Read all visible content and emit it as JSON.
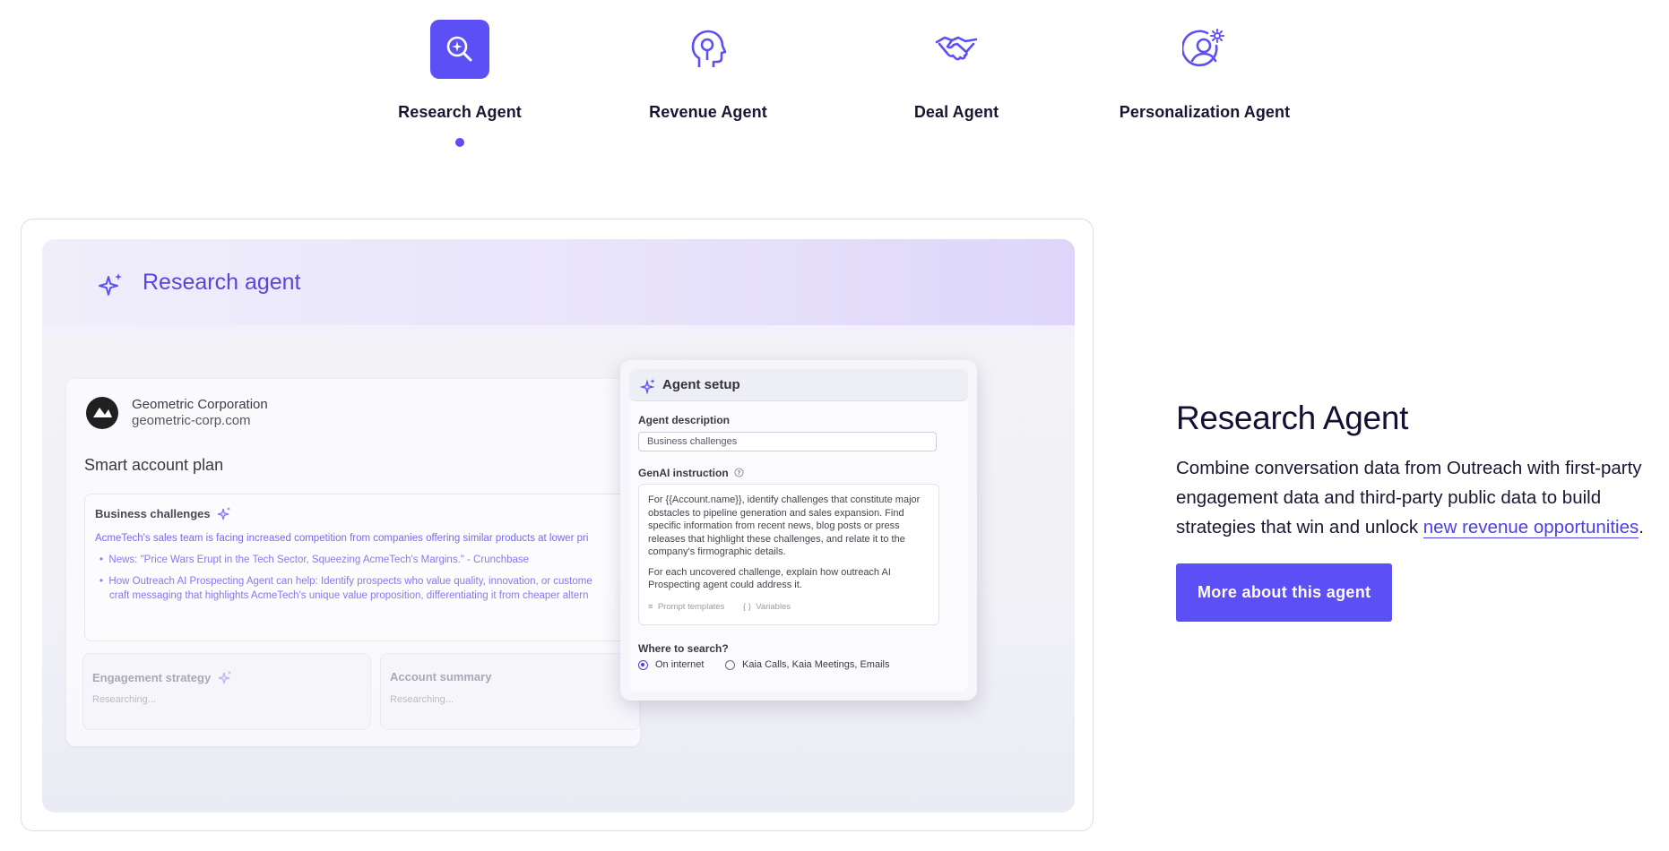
{
  "tabs": [
    {
      "label": "Research Agent",
      "icon": "magnifier-sparkle-icon",
      "active": true
    },
    {
      "label": "Revenue Agent",
      "icon": "head-profile-icon",
      "active": false
    },
    {
      "label": "Deal Agent",
      "icon": "handshake-icon",
      "active": false
    },
    {
      "label": "Personalization Agent",
      "icon": "user-gear-icon",
      "active": false
    }
  ],
  "preview": {
    "title": "Research agent",
    "account": {
      "name": "Geometric Corporation",
      "domain": "geometric-corp.com",
      "plan_title": "Smart account plan",
      "business_challenges": {
        "title": "Business challenges",
        "summary": "AcmeTech's sales team is facing increased competition from companies offering similar products at lower pri",
        "bullet1": "News: \"Price Wars Erupt in the Tech Sector, Squeezing AcmeTech's Margins.\" - Crunchbase",
        "bullet2a": "How Outreach AI Prospecting Agent can help: Identify prospects who value quality, innovation, or custome",
        "bullet2b": "craft messaging that highlights AcmeTech's unique value proposition, differentiating it from cheaper altern"
      },
      "engagement": {
        "title": "Engagement strategy",
        "status": "Researching..."
      },
      "summary": {
        "title": "Account summary",
        "status": "Researching..."
      }
    },
    "setup": {
      "title": "Agent setup",
      "desc_label": "Agent description",
      "desc_value": "Business challenges",
      "genai_label": "GenAI instruction",
      "instruction_p1": "For {{Account.name}}, identify challenges that constitute major obstacles to pipeline generation and sales expansion. Find specific information from recent news, blog posts or press releases that highlight these challenges, and relate it to the company's firmographic details.",
      "instruction_p2": "For each uncovered challenge, explain how outreach AI Prospecting agent could address it.",
      "prompt_templates": "Prompt templates",
      "variables": "Variables",
      "search_label": "Where to search?",
      "option1": "On internet",
      "option2": "Kaia Calls, Kaia Meetings, Emails"
    }
  },
  "side": {
    "heading": "Research Agent",
    "desc_before": "Combine conversation data from Outreach with first-party engagement data and third-party public data to build strategies that win and unlock ",
    "link": "new revenue opportunities",
    "desc_after": ".",
    "cta": "More about this agent"
  },
  "colors": {
    "accent": "#5b4ff5",
    "heading": "#150f33"
  }
}
